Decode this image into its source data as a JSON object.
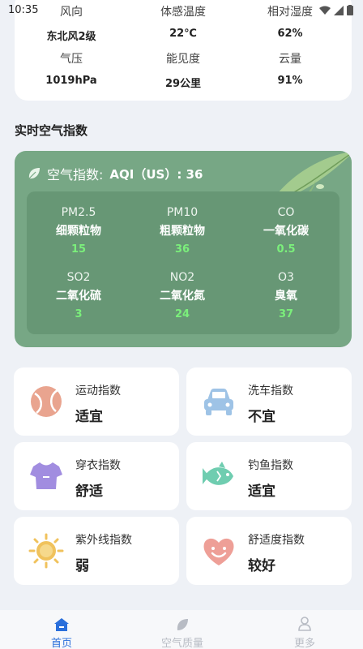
{
  "status_bar": {
    "time": "10:35"
  },
  "weather": {
    "row1": [
      {
        "label": "风向",
        "value": "东北风2级"
      },
      {
        "label": "体感温度",
        "value": "22℃"
      },
      {
        "label": "相对湿度",
        "value": "62%"
      }
    ],
    "row2": [
      {
        "label": "气压",
        "value": "1019hPa"
      },
      {
        "label": "能见度",
        "value": "29公里"
      },
      {
        "label": "云量",
        "value": "91%"
      }
    ]
  },
  "air_section_title": "实时空气指数",
  "air": {
    "heading_label": "空气指数:",
    "heading_value": "AQI（US）: 36",
    "pollutants": [
      {
        "code": "PM2.5",
        "name": "细颗粒物",
        "value": "15"
      },
      {
        "code": "PM10",
        "name": "粗颗粒物",
        "value": "36"
      },
      {
        "code": "CO",
        "name": "一氧化碳",
        "value": "0.5"
      },
      {
        "code": "SO2",
        "name": "二氧化硫",
        "value": "3"
      },
      {
        "code": "NO2",
        "name": "二氧化氮",
        "value": "24"
      },
      {
        "code": "O3",
        "name": "臭氧",
        "value": "37"
      }
    ],
    "colors": {
      "card": "#77a785",
      "inner": "#679775",
      "value": "#7bef7b"
    }
  },
  "indices": [
    {
      "title": "运动指数",
      "status": "适宜",
      "icon": "sport-ball-icon"
    },
    {
      "title": "洗车指数",
      "status": "不宜",
      "icon": "car-icon"
    },
    {
      "title": "穿衣指数",
      "status": "舒适",
      "icon": "tshirt-icon"
    },
    {
      "title": "钓鱼指数",
      "status": "适宜",
      "icon": "fish-icon"
    },
    {
      "title": "紫外线指数",
      "status": "弱",
      "icon": "sun-icon"
    },
    {
      "title": "舒适度指数",
      "status": "较好",
      "icon": "heart-smile-icon"
    }
  ],
  "bottom_nav": {
    "items": [
      {
        "label": "首页",
        "icon": "home-icon",
        "active": true
      },
      {
        "label": "空气质量",
        "icon": "air-quality-icon",
        "active": false
      },
      {
        "label": "更多",
        "icon": "person-icon",
        "active": false
      }
    ],
    "active_color": "#2a6fdb",
    "inactive_color": "#b8bcc4"
  }
}
